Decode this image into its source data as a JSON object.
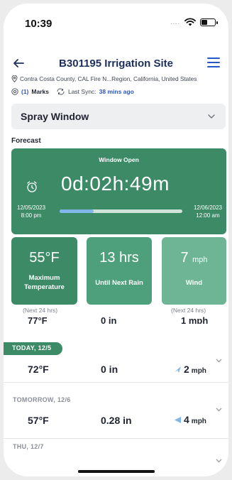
{
  "status_bar": {
    "time": "10:39",
    "signal_dots": "....",
    "battery_level": 0.5
  },
  "header": {
    "title": "B301195 Irrigation Site"
  },
  "location": "Contra Costa County, CAL Fire N...Region, California, United States",
  "meta": {
    "marks_count": "(1)",
    "marks_label": "Marks",
    "sync_label": "Last Sync:",
    "sync_value": "38 mins ago"
  },
  "dropdown": {
    "selected": "Spray Window"
  },
  "forecast": {
    "label": "Forecast",
    "window": {
      "status": "Window Open",
      "countdown": "0d:02h:49m",
      "start_date": "12/05/2023",
      "start_time": "8:00 pm",
      "end_date": "12/06/2023",
      "end_time": "12:00 am",
      "progress": 0.28
    },
    "stats": [
      {
        "value": "55°F",
        "unit": "",
        "label_line1": "Maximum",
        "label_line2": "Temperature"
      },
      {
        "value": "13 hrs",
        "unit": "",
        "label_line1": "Until Next Rain",
        "label_line2": ""
      },
      {
        "value": "7",
        "unit": "mph",
        "label_line1": "Wind",
        "label_line2": ""
      }
    ],
    "next24_left": "(Next 24 hrs)",
    "next24_right": "(Next 24 hrs)"
  },
  "cutoff_row": {
    "temp": "77°F",
    "rain": "0 in",
    "wind": "1 mph"
  },
  "days": [
    {
      "label": "TODAY, 12/5",
      "temp": "72°F",
      "rain": "0 in",
      "wind_value": "2",
      "wind_unit": "mph"
    },
    {
      "label": "TOMORROW, 12/6",
      "temp": "57°F",
      "rain": "0.28 in",
      "wind_value": "4",
      "wind_unit": "mph"
    },
    {
      "label": "THU, 12/7"
    }
  ],
  "colors": {
    "accent_green": "#3c8a66",
    "brand_blue": "#2856c6",
    "title_navy": "#1d2f5c"
  }
}
